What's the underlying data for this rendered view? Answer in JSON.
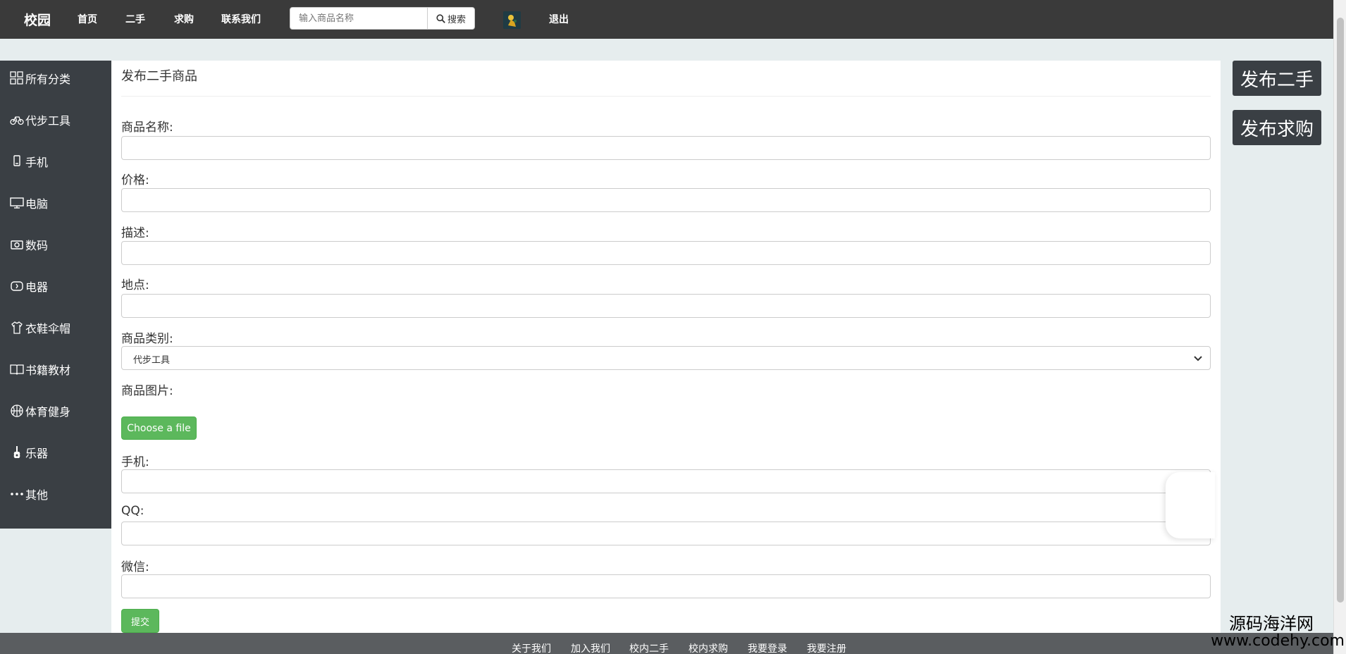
{
  "navbar": {
    "brand": "校园",
    "links": [
      "首页",
      "二手",
      "求购",
      "联系我们"
    ],
    "search_placeholder": "输入商品名称",
    "search_button": "搜索",
    "logout": "退出"
  },
  "sidebar": {
    "items": [
      {
        "label": "所有分类",
        "icon": "grid-icon"
      },
      {
        "label": "代步工具",
        "icon": "bicycle-icon"
      },
      {
        "label": "手机",
        "icon": "phone-icon"
      },
      {
        "label": "电脑",
        "icon": "monitor-icon"
      },
      {
        "label": "数码",
        "icon": "camera-icon"
      },
      {
        "label": "电器",
        "icon": "tv-icon"
      },
      {
        "label": "衣鞋伞帽",
        "icon": "shirt-icon"
      },
      {
        "label": "书籍教材",
        "icon": "book-icon"
      },
      {
        "label": "体育健身",
        "icon": "basketball-icon"
      },
      {
        "label": "乐器",
        "icon": "guitar-icon"
      },
      {
        "label": "其他",
        "icon": "more-icon"
      }
    ]
  },
  "form": {
    "title": "发布二手商品",
    "fields": {
      "name": {
        "label": "商品名称:",
        "value": ""
      },
      "price": {
        "label": "价格:",
        "value": ""
      },
      "description": {
        "label": "描述:",
        "value": ""
      },
      "location": {
        "label": "地点:",
        "value": ""
      },
      "category": {
        "label": "商品类别:",
        "selected": "代步工具"
      },
      "image": {
        "label": "商品图片:",
        "button": "Choose a file"
      },
      "phone": {
        "label": "手机:",
        "value": ""
      },
      "qq": {
        "label": "QQ:",
        "value": ""
      },
      "wechat": {
        "label": "微信:",
        "value": ""
      }
    },
    "submit": "提交"
  },
  "actions": {
    "publish_used": "发布二手",
    "publish_request": "发布求购"
  },
  "footer": {
    "links": [
      "关于我们",
      "加入我们",
      "校内二手",
      "校内求购",
      "我要登录",
      "我要注册"
    ]
  },
  "watermark": {
    "name": "源码海洋网",
    "url": "www.codehy.com"
  },
  "colors": {
    "navbar": "#3a3a3a",
    "sidebar": "#3a3f44",
    "success": "#5cb85c",
    "background": "#e6edee"
  }
}
